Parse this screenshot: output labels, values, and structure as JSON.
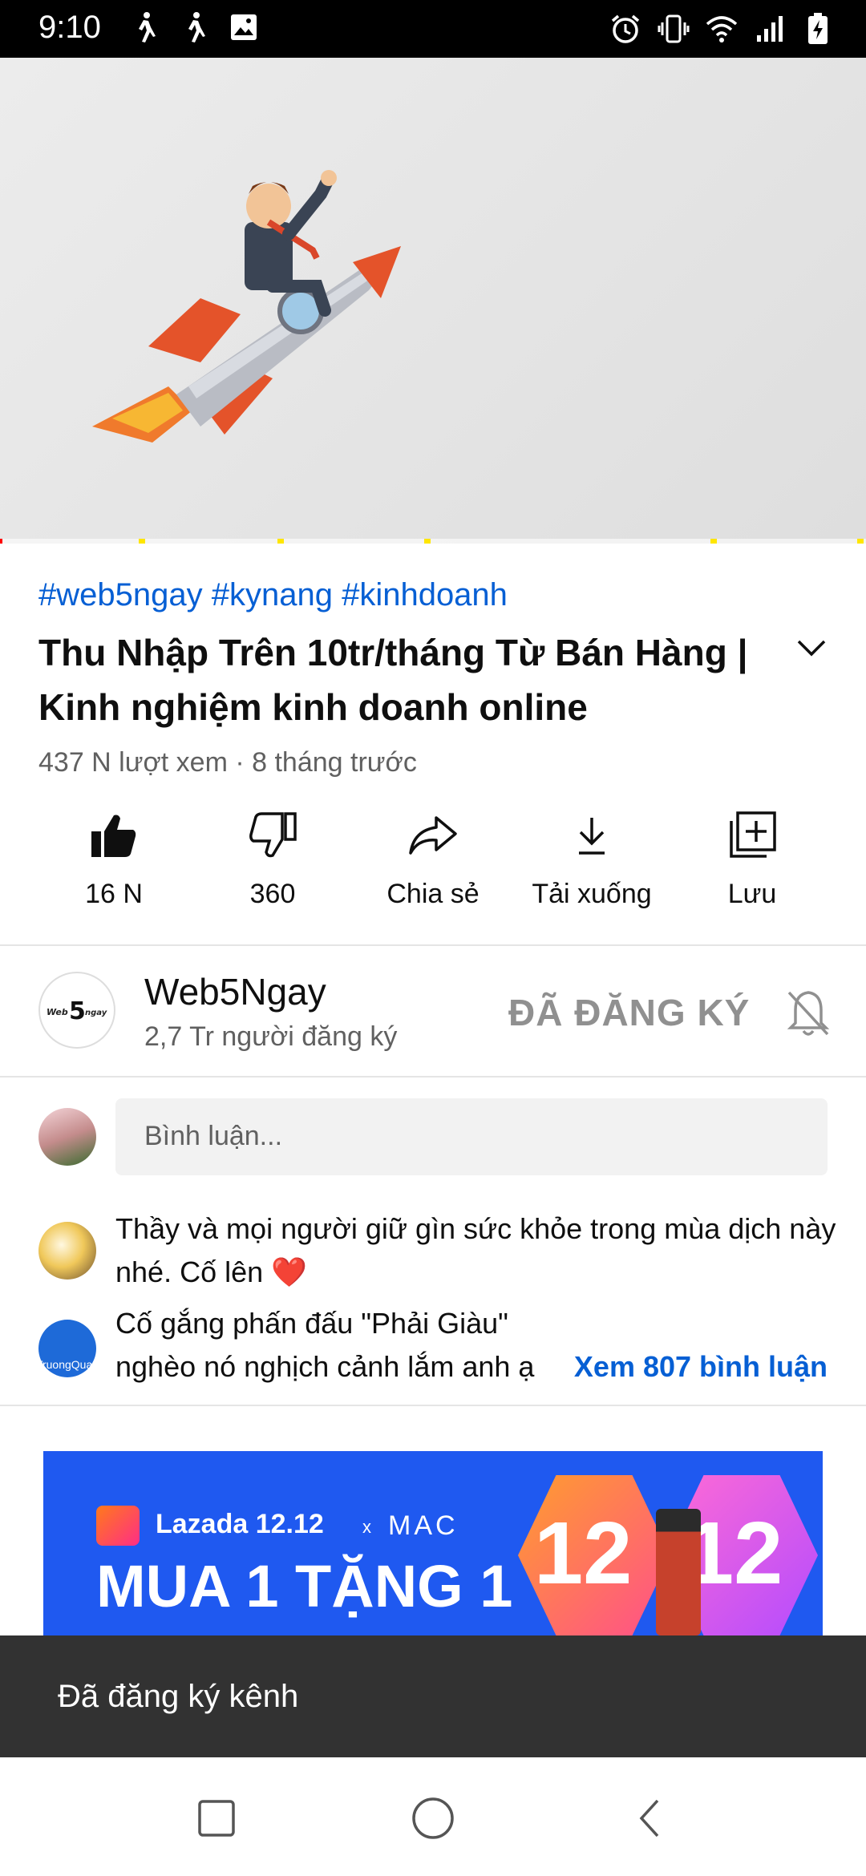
{
  "status_bar": {
    "time": "9:10",
    "left_icons": [
      "walk-icon",
      "walk-icon",
      "image-icon"
    ],
    "right_icons": [
      "alarm-icon",
      "vibrate-icon",
      "wifi-icon",
      "signal-icon",
      "battery-charging-icon"
    ]
  },
  "video": {
    "progress_fraction": 0.003,
    "ad_markers_fraction": [
      0.16,
      0.32,
      0.49,
      0.82,
      0.99
    ]
  },
  "video_info": {
    "hashtags": "#web5ngay #kynang #kinhdoanh",
    "title": "Thu Nhập Trên 10tr/tháng Từ Bán Hàng | Kinh nghiệm kinh doanh online",
    "meta": "437 N lượt xem · 8 tháng trước"
  },
  "actions": {
    "like": "16 N",
    "dislike": "360",
    "share": "Chia sẻ",
    "download": "Tải xuống",
    "save": "Lưu"
  },
  "channel": {
    "name": "Web5Ngay",
    "subscribers": "2,7 Tr người đăng ký",
    "subscribe_state": "ĐÃ ĐĂNG KÝ"
  },
  "comments": {
    "input_placeholder": "Bình luận...",
    "items": [
      {
        "text": "Thầy và mọi người giữ gìn sức khỏe trong mùa dịch này nhé. Cố lên ❤️"
      },
      {
        "line1": "Cố gắng phấn đấu \"Phải Giàu\"",
        "line2": "nghèo nó nghịch cảnh lắm anh ạ"
      }
    ],
    "avatar2_text": "TruongQuan",
    "see_all": "Xem 807 bình luận"
  },
  "ad": {
    "brand": "Lazada 12.12",
    "collab_x": "x",
    "collab_brand": "MAC",
    "promo": "MUA 1 TẶNG 1",
    "num1": "12",
    "num2": "12"
  },
  "snackbar": {
    "text": "Đã đăng ký kênh"
  },
  "colors": {
    "link_blue": "#065fd4",
    "progress_red": "#ff0000",
    "ad_marker_yellow": "#ffe600",
    "snackbar_bg": "#323232",
    "ad_bg": "#1f59f0"
  }
}
